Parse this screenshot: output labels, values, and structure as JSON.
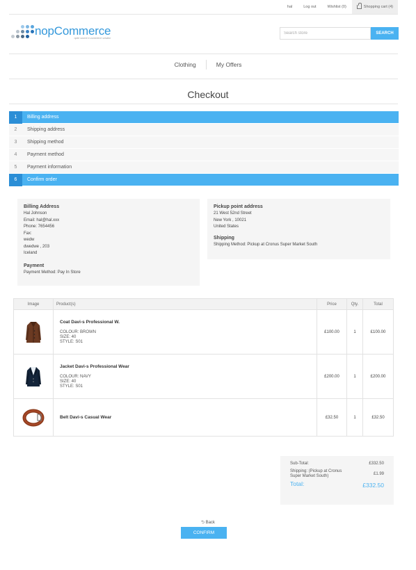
{
  "header": {
    "user": "hal",
    "logout": "Log out",
    "wishlist": "Wishlist (0)",
    "cart": "Shopping cart (4)"
  },
  "logo": {
    "name": "nopCommerce",
    "tagline": "open source e-commerce solution"
  },
  "search": {
    "placeholder": "Search store",
    "button": "SEARCH"
  },
  "menu": [
    "Clothing",
    "My Offers"
  ],
  "page_title": "Checkout",
  "steps": [
    {
      "num": "1",
      "label": "Billing address",
      "active": true
    },
    {
      "num": "2",
      "label": "Shipping address",
      "active": false
    },
    {
      "num": "3",
      "label": "Shipping method",
      "active": false
    },
    {
      "num": "4",
      "label": "Payment method",
      "active": false
    },
    {
      "num": "5",
      "label": "Payment information",
      "active": false
    },
    {
      "num": "6",
      "label": "Confirm order",
      "active": true
    }
  ],
  "billing": {
    "title": "Billing Address",
    "lines": [
      "Hal Johnson",
      "Email: hal@hal.xxx",
      "Phone: 7654456",
      "Fax:",
      "wedw",
      "dwedwe , 203",
      "Iceland"
    ],
    "payment_title": "Payment",
    "payment_method": "Payment Method: Pay In Store"
  },
  "pickup": {
    "title": "Pickup point address",
    "lines": [
      "21 West 52nd Street",
      "New York , 10021",
      "United States"
    ],
    "shipping_title": "Shipping",
    "shipping_method": "Shipping Method: Pickup at Cronus Super Market South"
  },
  "cart": {
    "columns": [
      "Image",
      "Product(s)",
      "Price",
      "Qty.",
      "Total"
    ],
    "rows": [
      {
        "name": "Coat Davi-s Professional W.",
        "attrs": [
          "COLOUR: BROWN",
          "SIZE: 40",
          "STYLE: S01"
        ],
        "price": "£100.00",
        "qty": "1",
        "total": "£100.00"
      },
      {
        "name": "Jacket Davi-s Professional Wear",
        "attrs": [
          "COLOUR: NAVY",
          "SIZE: 40",
          "STYLE: S01"
        ],
        "price": "£200.00",
        "qty": "1",
        "total": "£200.00"
      },
      {
        "name": "Belt Davi-s Casual Wear",
        "attrs": [],
        "price": "£32.50",
        "qty": "1",
        "total": "£32.50"
      }
    ]
  },
  "totals": {
    "subtotal_label": "Sub-Total:",
    "subtotal": "£332.50",
    "shipping_label": "Shipping: (Pickup at Cronus Super Market South)",
    "shipping": "£1.99",
    "total_label": "Total:",
    "total": "£332.50"
  },
  "back": "Back",
  "confirm": "CONFIRM",
  "colors": {
    "accent": "#4ab2f1",
    "accent_dark": "#2b8ed6"
  }
}
